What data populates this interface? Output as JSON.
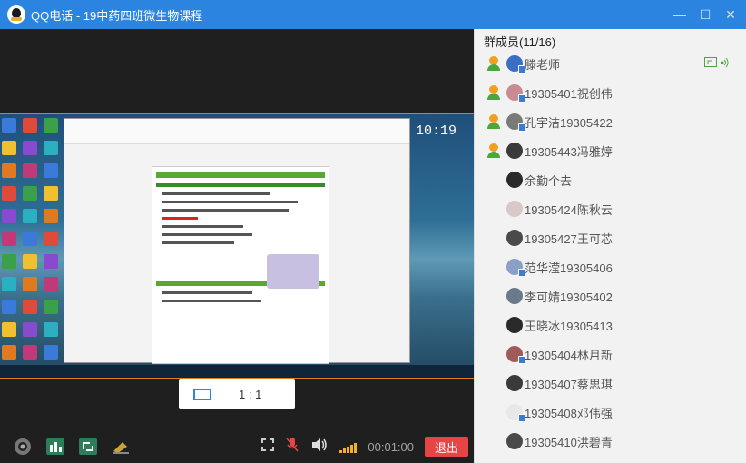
{
  "window": {
    "title": "QQ电话 - 19中药四班微生物课程",
    "controls": [
      "minimize",
      "maximize",
      "close"
    ]
  },
  "video": {
    "aspect_ratio_label": "1 : 1",
    "shared_screen_clock": "10:19"
  },
  "toolbar": {
    "left_icons": [
      "camera-icon",
      "stats-icon",
      "screen-share-icon",
      "whiteboard-icon"
    ],
    "right_icons": [
      "fullscreen-icon",
      "mic-muted-icon",
      "speaker-icon",
      "signal-icon"
    ],
    "timer": "00:01:00",
    "exit_label": "退出"
  },
  "members": {
    "header": "群成员(11/16)",
    "list": [
      {
        "name": "滕老师",
        "role": "admin",
        "device": true,
        "avatar_color": "#3a6fc4",
        "sharing": true
      },
      {
        "name": "19305401祝创伟",
        "role": "admin",
        "device": true,
        "avatar_color": "#c98a92",
        "sharing": false
      },
      {
        "name": "孔宇洁19305422",
        "role": "admin",
        "device": true,
        "avatar_color": "#7a7a7a",
        "sharing": false
      },
      {
        "name": "19305443冯雅婷",
        "role": "admin",
        "device": false,
        "avatar_color": "#3a3a3a",
        "sharing": false
      },
      {
        "name": "余勤个去",
        "role": "member",
        "device": false,
        "avatar_color": "#2a2a2a",
        "sharing": false
      },
      {
        "name": "19305424陈秋云",
        "role": "member",
        "device": false,
        "avatar_color": "#d8c8c8",
        "sharing": false
      },
      {
        "name": "19305427王可芯",
        "role": "member",
        "device": false,
        "avatar_color": "#4a4a4a",
        "sharing": false
      },
      {
        "name": "范华滢19305406",
        "role": "member",
        "device": true,
        "avatar_color": "#8aa0c8",
        "sharing": false
      },
      {
        "name": "李可婧19305402",
        "role": "member",
        "device": false,
        "avatar_color": "#6a7a8a",
        "sharing": false
      },
      {
        "name": "王晓冰19305413",
        "role": "member",
        "device": false,
        "avatar_color": "#2a2a2a",
        "sharing": false
      },
      {
        "name": "19305404林月新",
        "role": "member",
        "device": true,
        "avatar_color": "#a05a5a",
        "sharing": false
      },
      {
        "name": "19305407蔡思琪",
        "role": "member",
        "device": false,
        "avatar_color": "#3a3a3a",
        "sharing": false
      },
      {
        "name": "19305408邓伟强",
        "role": "member",
        "device": true,
        "avatar_color": "#e8e8e8",
        "sharing": false
      },
      {
        "name": "19305410洪碧青",
        "role": "member",
        "device": false,
        "avatar_color": "#4a4a4a",
        "sharing": false
      }
    ]
  },
  "colors": {
    "titlebar": "#2b84e0",
    "exit_button": "#e54545",
    "accent_green": "#4aa83a"
  }
}
